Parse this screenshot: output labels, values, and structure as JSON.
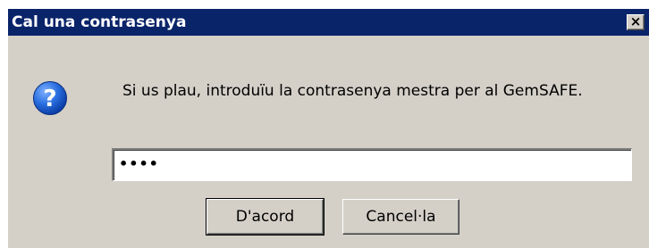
{
  "dialog": {
    "title": "Cal una contrasenya",
    "close_symbol": "×",
    "icon": "question-icon",
    "message": "Si us plau, introduïu la contrasenya mestra per al GemSAFE.",
    "password_value": "••••",
    "ok_label": "D'acord",
    "cancel_label": "Cancel·la"
  },
  "colors": {
    "titlebar": "#0a246a",
    "dialog_bg": "#d4d0c8",
    "icon_blue": "#1c64d8"
  }
}
